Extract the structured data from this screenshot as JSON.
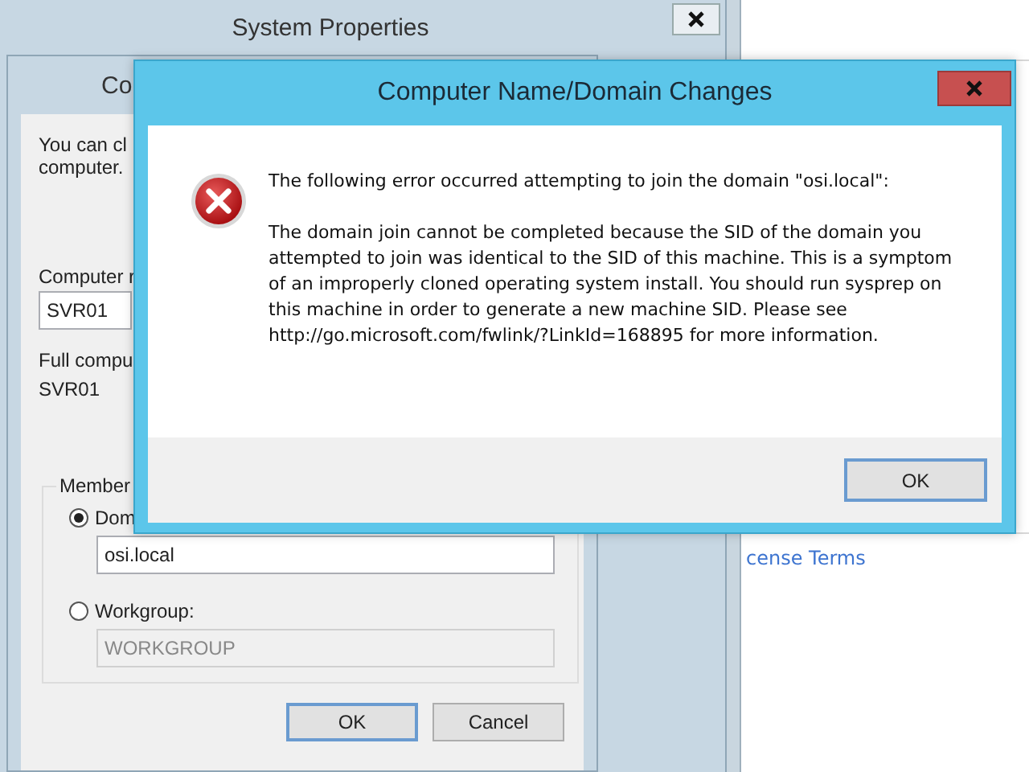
{
  "background_window": {
    "link": "cense Terms"
  },
  "system_properties": {
    "title": "System Properties"
  },
  "computer_name_dialog": {
    "title": "Co",
    "intro_lines": [
      "You can cl",
      "computer."
    ],
    "computer_name_label": "Computer r",
    "computer_name": "SVR01",
    "full_name_label": "Full compu",
    "full_name": "SVR01",
    "member_of": {
      "label": "Member",
      "options": [
        {
          "label": "Dom",
          "selected": true,
          "value": "osi.local",
          "disabled": false
        },
        {
          "label": "Workgroup:",
          "selected": false,
          "value": "WORKGROUP",
          "disabled": true
        }
      ]
    },
    "buttons": [
      {
        "label": "OK",
        "default": true
      },
      {
        "label": "Cancel",
        "default": false
      }
    ]
  },
  "error_dialog": {
    "title": "Computer Name/Domain Changes",
    "heading": "The following error occurred attempting to join the domain \"osi.local\":",
    "message": "The domain join cannot be completed because the SID of the domain you attempted to join was identical to the SID of this machine. This is a symptom of an improperly cloned operating system install.  You should run sysprep on this machine in order to generate a new machine SID. Please see http://go.microsoft.com/fwlink/?LinkId=168895 for more information.",
    "buttons": [
      {
        "label": "OK",
        "default": true
      }
    ]
  }
}
